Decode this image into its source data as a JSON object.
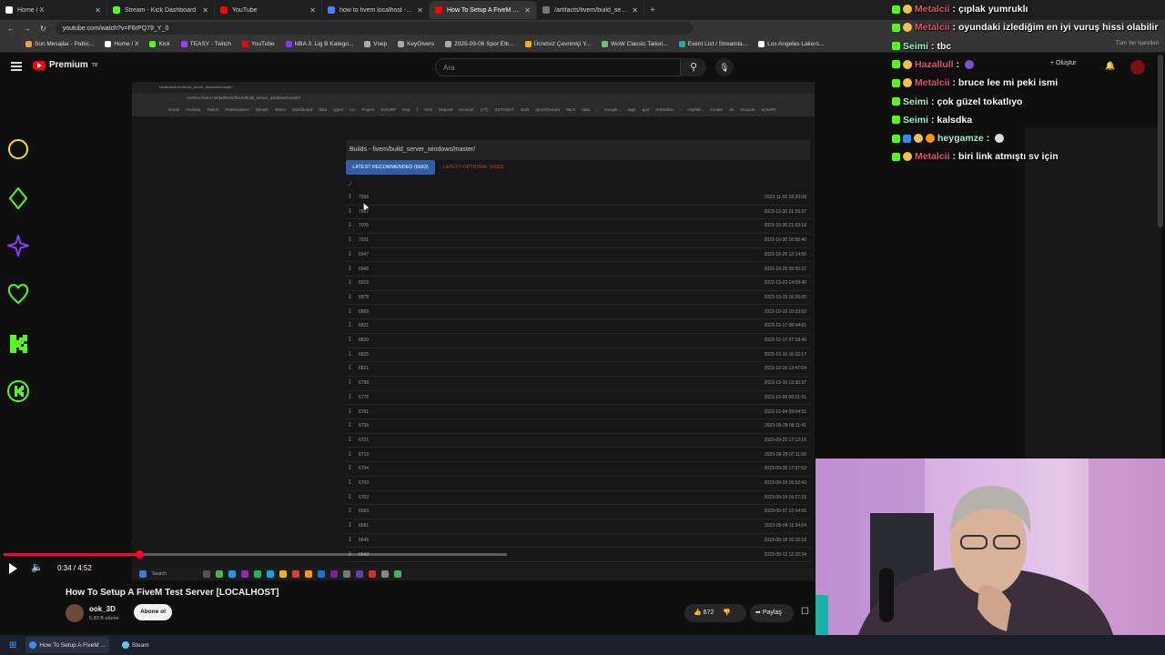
{
  "browser": {
    "tabs": [
      {
        "label": "Home / X",
        "color": "#ffffff"
      },
      {
        "label": "Stream - Kick Dashboard",
        "color": "#53fc18"
      },
      {
        "label": "YouTube",
        "color": "#ff0000"
      },
      {
        "label": "how to fivem localhost - Googl",
        "color": "#4285f4"
      },
      {
        "label": "How To Setup A FiveM Test Serv",
        "color": "#ff0000"
      },
      {
        "label": "/artifacts/fivem/build_server_w",
        "color": "#777777"
      }
    ],
    "active_tab_index": 4,
    "url": "youtube.com/watch?v=F6rPQ79_Y_0",
    "bookmarks": [
      "Son Mesajlar - Pabic...",
      "Home / X",
      "Kick",
      "TEASY - Twitch",
      "YouTube",
      "NBA 3. Lig B Katego...",
      "Vsep",
      "KeyGivers",
      "2025-09-06 Spor Etk...",
      "Ücretsiz Çevrimiçi Y...",
      "WoW Classic Tailori...",
      "Event List / Streamla...",
      "Los Angeles Lakers..."
    ],
    "bookmarks_right": "Tüm Yer İşaretleri"
  },
  "youtube": {
    "brand": "Premium",
    "brand_sup": "TR",
    "search_placeholder": "Ara",
    "create_label": "Oluştur"
  },
  "embedded": {
    "tab_label": "/artifacts/fivem/build_server_windows/master/",
    "address": "runtime.fivem.net/artifacts/fivem/build_server_windows/master/",
    "bookmarks": "Gmail Youtube Twitch Fleetmasters GitHub Tebex Dashboard data types LC Project EchoRP eUp | Kick Deposit Account (YT) ZSTHOST SUN QuickTexture MLO data - Google... rage gun ArtStation - Asphal... Create an Account echoRP",
    "title": "Builds - fivem/build_server_windows/master/",
    "btn_recommended": "LATEST RECOMMENDED (6683)",
    "btn_optional": "LATEST OPTIONAL (6683)",
    "parent_dir": "../",
    "builds": [
      {
        "num": "7056",
        "date": "2023-11-02 16:20:08"
      },
      {
        "num": "7037",
        "date": "2023-10-30 21:59:37"
      },
      {
        "num": "7035",
        "date": "2023-10-30 21:03:16"
      },
      {
        "num": "7031",
        "date": "2023-10-30 16:55:40"
      },
      {
        "num": "6947",
        "date": "2023-10-25 12:14:56"
      },
      {
        "num": "6945",
        "date": "2023-10-25 09:55:37"
      },
      {
        "num": "6919",
        "date": "2023-10-23 14:59:40"
      },
      {
        "num": "6878",
        "date": "2023-10-19 16:26:00"
      },
      {
        "num": "6868",
        "date": "2023-10-19 10:03:50"
      },
      {
        "num": "6831",
        "date": "2023-10-17 08:44:01"
      },
      {
        "num": "6830",
        "date": "2023-10-17 07:19:46"
      },
      {
        "num": "6825",
        "date": "2023-10-16 16:32:17"
      },
      {
        "num": "6821",
        "date": "2023-10-16 13:47:04"
      },
      {
        "num": "6798",
        "date": "2023-10-10 13:30:37"
      },
      {
        "num": "6775",
        "date": "2023-10-09 09:01:51"
      },
      {
        "num": "6761",
        "date": "2023-10-04 09:04:51"
      },
      {
        "num": "6736",
        "date": "2023-09-28 08:11:41"
      },
      {
        "num": "6721",
        "date": "2023-09-25 17:12:16"
      },
      {
        "num": "6719",
        "date": "2023-09-25 07:11:06"
      },
      {
        "num": "6704",
        "date": "2023-09-20 17:07:53"
      },
      {
        "num": "6703",
        "date": "2023-09-19 16:52:43"
      },
      {
        "num": "6702",
        "date": "2023-09-19 16:27:15"
      },
      {
        "num": "6683",
        "date": "2023-09-07 12:14:50"
      },
      {
        "num": "6681",
        "date": "2023-09-04 11:34:04"
      },
      {
        "num": "6645",
        "date": "2023-08-18 15:15:19"
      },
      {
        "num": "6643",
        "date": "2023-08-13 12:32:34"
      }
    ],
    "taskbar_search": "Search"
  },
  "player": {
    "time": "0:34 / 4:52",
    "progress": 0.27,
    "buffered": 1.0
  },
  "video": {
    "title": "How To Setup A FiveM Test Server [LOCALHOST]",
    "channel": "ook_3D",
    "subscribers": "5,83 B abone",
    "subscribe_label": "Abone ol",
    "likes": "672",
    "share_label": "Paylaş"
  },
  "taskbar": {
    "items": [
      "How To Setup A FiveM ...",
      "Steam"
    ]
  },
  "chat": [
    {
      "user": "Metalcii",
      "user_color": "#e0556b",
      "text": "çıplak yumruklı"
    },
    {
      "user": "Metalcii",
      "user_color": "#e0556b",
      "text": "oyundaki izlediğim en iyi vuruş hissi olabilir"
    },
    {
      "user": "Seimi",
      "user_color": "#9ef7c9",
      "text": "tbc"
    },
    {
      "user": "Hazallull",
      "user_color": "#e0556b",
      "text": ""
    },
    {
      "user": "Metalcii",
      "user_color": "#e0556b",
      "text": "bruce lee mi peki ismi"
    },
    {
      "user": "Seimi",
      "user_color": "#9ef7c9",
      "text": "çok güzel tokatlıyo"
    },
    {
      "user": "Seimi",
      "user_color": "#9ef7c9",
      "text": "kalsdka"
    },
    {
      "user": "heygamze",
      "user_color": "#9ef7c9",
      "text": ""
    },
    {
      "user": "Metalcii",
      "user_color": "#e0556b",
      "text": "biri link atmıştı sv için"
    }
  ],
  "colors": {
    "accent_red": "#ff0033",
    "kick_green": "#53fc18",
    "overlay_yellow": "#f5e22a",
    "overlay_purple": "#8a3cff"
  },
  "icons": [
    "menu-icon",
    "search-icon",
    "mic-icon",
    "bell-icon",
    "play-icon",
    "volume-icon",
    "like-icon",
    "dislike-icon",
    "share-icon",
    "save-icon"
  ]
}
